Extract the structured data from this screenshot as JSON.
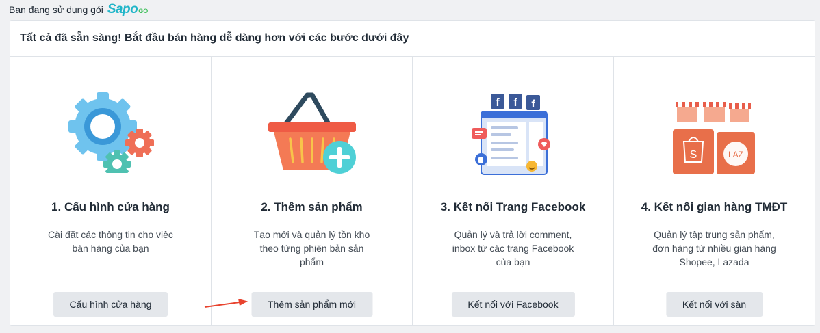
{
  "plan": {
    "prefix": "Bạn đang sử dụng gói",
    "brand_main": "Sapo",
    "brand_sub": "GO"
  },
  "header": {
    "title": "Tất cả đã sẵn sàng! Bắt đầu bán hàng dễ dàng hơn với các bước dưới đây"
  },
  "steps": [
    {
      "title": "1. Cấu hình cửa hàng",
      "desc": "Cài đặt các thông tin cho việc bán hàng của bạn",
      "button": "Cấu hình cửa hàng",
      "icon": "gears-icon"
    },
    {
      "title": "2. Thêm sản phẩm",
      "desc": "Tạo mới và quản lý tồn kho theo từng phiên bản sản phẩm",
      "button": "Thêm sản phẩm mới",
      "icon": "basket-add-icon"
    },
    {
      "title": "3. Kết nối Trang Facebook",
      "desc": "Quản lý và trả lời comment, inbox từ các trang Facebook của bạn",
      "button": "Kết nối với Facebook",
      "icon": "facebook-page-icon"
    },
    {
      "title": "4. Kết nối gian hàng TMĐT",
      "desc": "Quản lý tập trung sản phẩm, đơn hàng từ nhiều gian hàng Shopee, Lazada",
      "button": "Kết nối với sàn",
      "icon": "marketplace-icon"
    }
  ],
  "illustration_text": {
    "facebook_letter": "f",
    "shopee_letter": "S",
    "lazada_letter": "LAZ"
  },
  "colors": {
    "brand": "#1fb5c8",
    "arrow": "#e8432e",
    "button_bg": "#e4e7eb"
  }
}
